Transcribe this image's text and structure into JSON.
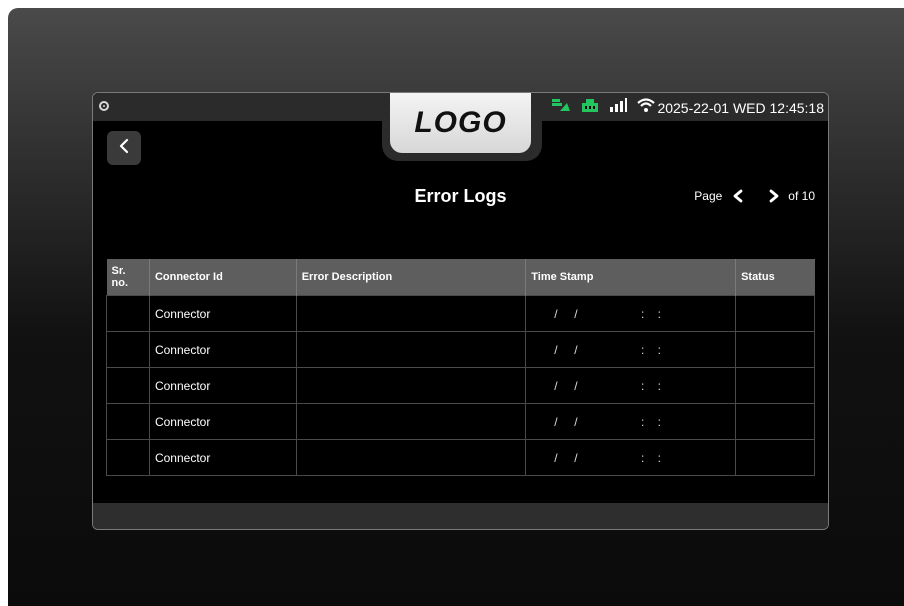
{
  "brand": {
    "logo_text": "LOGO"
  },
  "status_bar": {
    "datetime": "2025-22-01 WED 12:45:18",
    "icons": [
      "ev-charge-icon",
      "ethernet-icon",
      "signal-bars-icon",
      "wifi-icon"
    ],
    "icon_color_green": "#22c55e",
    "icon_color_white": "#ffffff"
  },
  "page": {
    "title": "Error Logs"
  },
  "pagination": {
    "label": "Page",
    "of_label": "of 10"
  },
  "table": {
    "headers": [
      "Sr. no.",
      "Connector Id",
      "Error Description",
      "Time Stamp",
      "Status"
    ],
    "rows": [
      {
        "sr": "",
        "connector": "Connector",
        "description": "",
        "timestamp": "/     /                   :    :",
        "status": ""
      },
      {
        "sr": "",
        "connector": "Connector",
        "description": "",
        "timestamp": "/     /                   :    :",
        "status": ""
      },
      {
        "sr": "",
        "connector": "Connector",
        "description": "",
        "timestamp": "/     /                   :    :",
        "status": ""
      },
      {
        "sr": "",
        "connector": "Connector",
        "description": "",
        "timestamp": "/     /                   :    :",
        "status": ""
      },
      {
        "sr": "",
        "connector": "Connector",
        "description": "",
        "timestamp": "/     /                   :    :",
        "status": ""
      }
    ]
  }
}
